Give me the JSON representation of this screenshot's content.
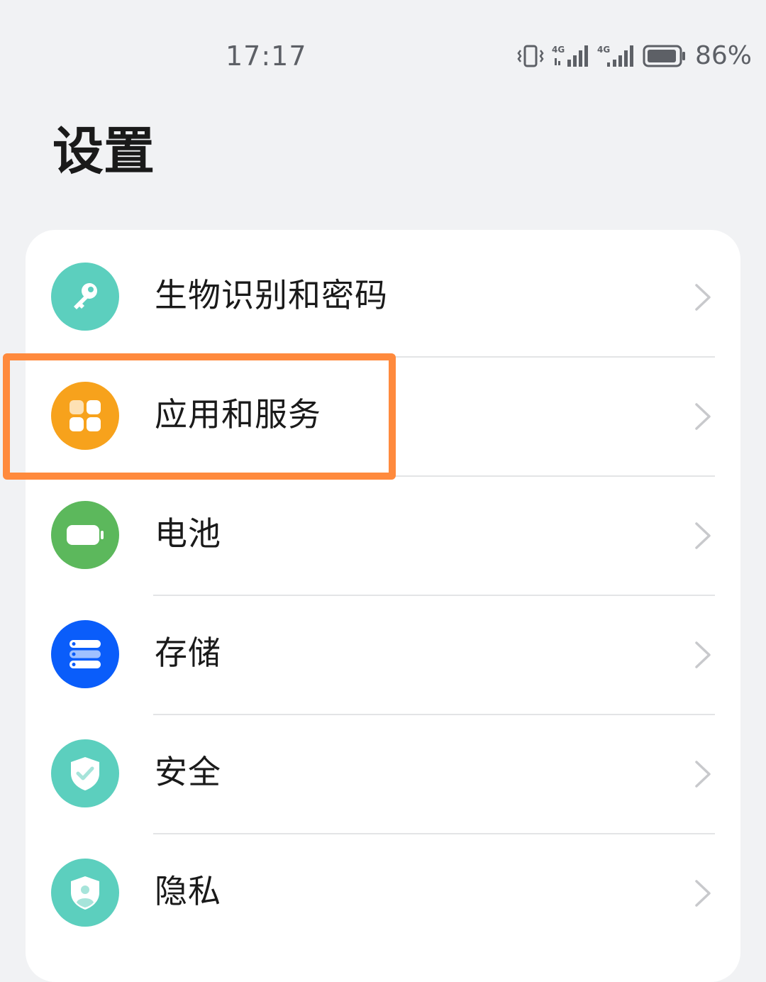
{
  "status_bar": {
    "time": "17:17",
    "battery_percent": "86%",
    "network_label_1": "4G",
    "network_label_2": "4G",
    "icons": [
      "vibrate-icon",
      "signal-4g-icon",
      "signal-4g-icon",
      "battery-icon"
    ]
  },
  "page": {
    "title": "设置"
  },
  "settings": {
    "items": [
      {
        "label": "生物识别和密码",
        "icon": "key-icon",
        "color": "#5ccfbe"
      },
      {
        "label": "应用和服务",
        "icon": "apps-grid-icon",
        "color": "#f7a21c"
      },
      {
        "label": "电池",
        "icon": "battery-icon",
        "color": "#5cb85c"
      },
      {
        "label": "存储",
        "icon": "storage-icon",
        "color": "#0a5dfa"
      },
      {
        "label": "安全",
        "icon": "shield-check-icon",
        "color": "#5ccfbe"
      },
      {
        "label": "隐私",
        "icon": "privacy-shield-icon",
        "color": "#5ccfbe"
      }
    ]
  },
  "highlight": {
    "target": "应用和服务",
    "color": "#ff8a3d"
  }
}
